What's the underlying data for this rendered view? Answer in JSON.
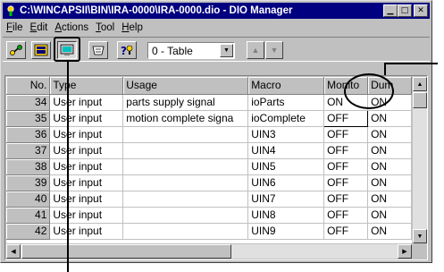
{
  "window": {
    "title": "C:\\WINCAPSII\\BIN\\IRA-0000\\IRA-0000.dio - DIO Manager",
    "minimize_glyph": "▁",
    "maximize_glyph": "□",
    "close_glyph": "✕"
  },
  "menu": [
    {
      "accel": "F",
      "rest": "ile"
    },
    {
      "accel": "E",
      "rest": "dit"
    },
    {
      "accel": "A",
      "rest": "ctions"
    },
    {
      "accel": "T",
      "rest": "ool"
    },
    {
      "accel": "H",
      "rest": "elp"
    }
  ],
  "toolbar": {
    "buttons": [
      "connect-icon",
      "list-icon",
      "monitor-icon",
      "io-setting-icon",
      "help-icon"
    ],
    "view_select_value": "0 - Table",
    "up_glyph": "▲",
    "down_glyph": "▼"
  },
  "table": {
    "columns": [
      "No.",
      "Type",
      "Usage",
      "Macro",
      "Monito",
      "Dum"
    ],
    "rows": [
      {
        "no": "34",
        "type": "User input",
        "usage": "parts supply signal",
        "macro": "ioParts",
        "monitor": "ON",
        "dummy": "ON"
      },
      {
        "no": "35",
        "type": "User input",
        "usage": "motion complete signa",
        "macro": "ioComplete",
        "monitor": "OFF",
        "dummy": "ON"
      },
      {
        "no": "36",
        "type": "User input",
        "usage": "",
        "macro": "UIN3",
        "monitor": "OFF",
        "dummy": "ON"
      },
      {
        "no": "37",
        "type": "User input",
        "usage": "",
        "macro": "UIN4",
        "monitor": "OFF",
        "dummy": "ON"
      },
      {
        "no": "38",
        "type": "User input",
        "usage": "",
        "macro": "UIN5",
        "monitor": "OFF",
        "dummy": "ON"
      },
      {
        "no": "39",
        "type": "User input",
        "usage": "",
        "macro": "UIN6",
        "monitor": "OFF",
        "dummy": "ON"
      },
      {
        "no": "40",
        "type": "User input",
        "usage": "",
        "macro": "UIN7",
        "monitor": "OFF",
        "dummy": "ON"
      },
      {
        "no": "41",
        "type": "User input",
        "usage": "",
        "macro": "UIN8",
        "monitor": "OFF",
        "dummy": "ON"
      },
      {
        "no": "42",
        "type": "User input",
        "usage": "",
        "macro": "UIN9",
        "monitor": "OFF",
        "dummy": "ON"
      }
    ]
  },
  "scrollbars": {
    "up": "▲",
    "down": "▼",
    "left": "◀",
    "right": "▶"
  },
  "colors": {
    "titlebar": "#000080",
    "face": "#c0c0c0"
  }
}
